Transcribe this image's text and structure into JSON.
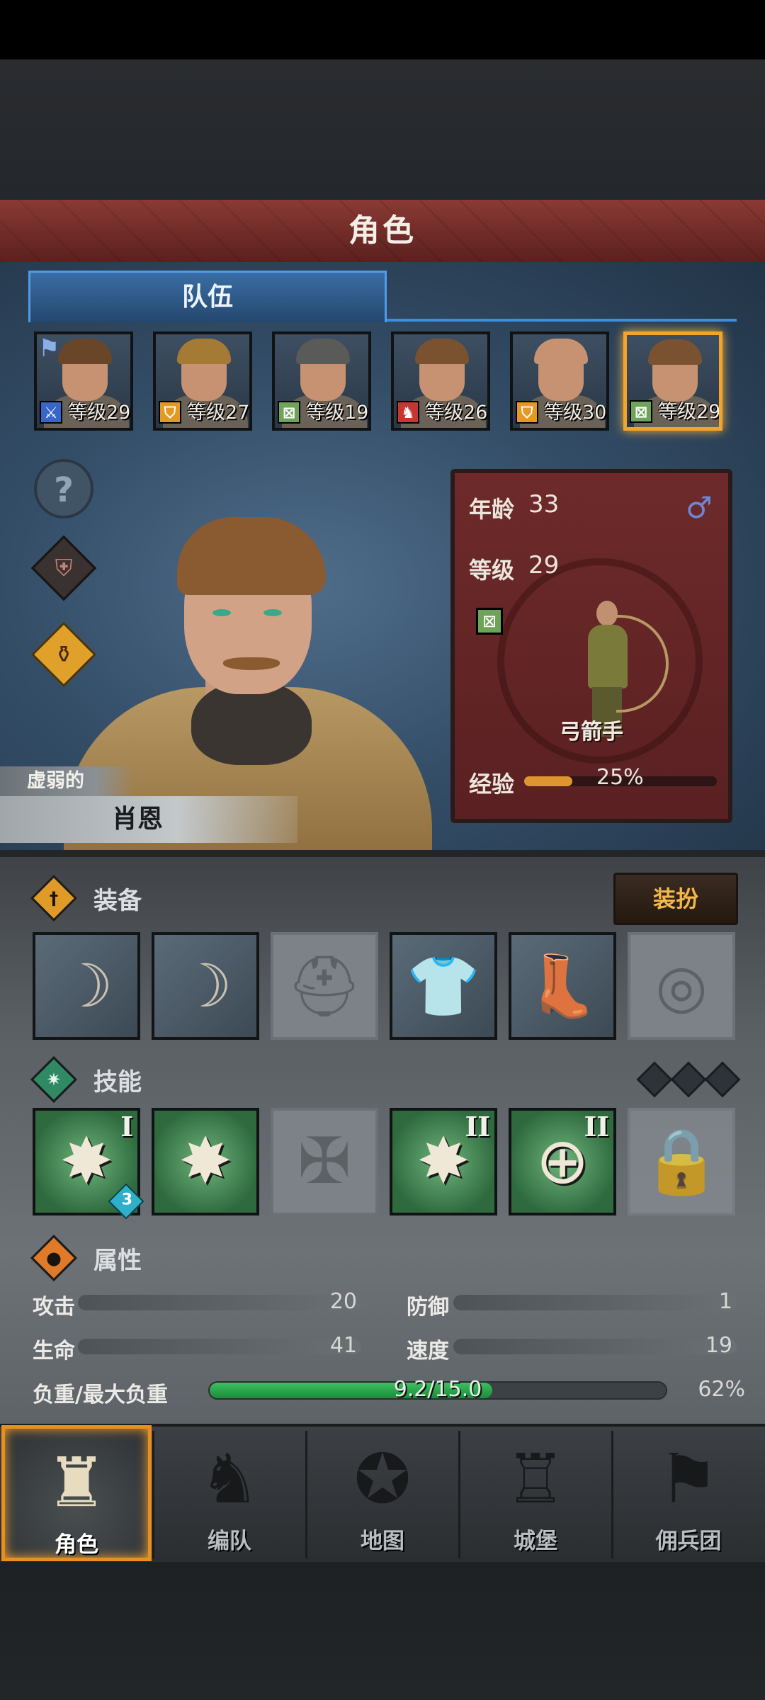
{
  "header": {
    "title": "角色"
  },
  "tabs": [
    {
      "label": "队伍"
    }
  ],
  "team": [
    {
      "class_icon": "sword-icon",
      "class_glyph": "⚔",
      "level_text": "等级29",
      "hair": "#6a4628",
      "banner": true
    },
    {
      "class_icon": "shield-icon",
      "class_glyph": "⛉",
      "level_text": "等级27",
      "hair": "#a57a34"
    },
    {
      "class_icon": "bow-icon",
      "class_glyph": "⊠",
      "level_text": "等级19",
      "hair": "#5a5a58"
    },
    {
      "class_icon": "beast-icon",
      "class_glyph": "♞",
      "level_text": "等级26",
      "hair": "#7a5230"
    },
    {
      "class_icon": "shield-icon",
      "class_glyph": "⛉",
      "level_text": "等级30",
      "hair": "#c79272"
    },
    {
      "class_icon": "bow-icon",
      "class_glyph": "⊠",
      "level_text": "等级29",
      "hair": "#7a5232",
      "selected": true
    }
  ],
  "side_icons": {
    "help": "?",
    "armor": "⛨",
    "potion": "⚱"
  },
  "hero": {
    "status": "虚弱的",
    "name": "肖恩"
  },
  "info": {
    "age_label": "年龄",
    "age": "33",
    "level_label": "等级",
    "level": "29",
    "gender_icon": "♂",
    "class_icon": "⊠",
    "class_name": "弓箭手",
    "exp_label": "经验",
    "exp_text": "25%",
    "exp_progress": 0.25
  },
  "sections": {
    "equipment": {
      "title": "装备",
      "icon": "†",
      "color": "#e09a28"
    },
    "skills": {
      "title": "技能",
      "icon": "✷",
      "color": "#2f8a64"
    },
    "attributes": {
      "title": "属性",
      "icon": "●",
      "color": "#e07a28"
    }
  },
  "dress_button": "装扮",
  "equipment_slots": [
    {
      "name": "bow-slot-1",
      "glyph": "☽",
      "filled": true
    },
    {
      "name": "bow-slot-2",
      "glyph": "☽",
      "filled": true
    },
    {
      "name": "helmet-slot",
      "glyph": "⛑",
      "filled": false
    },
    {
      "name": "chest-slot",
      "glyph": "👕",
      "filled": true
    },
    {
      "name": "boots-slot",
      "glyph": "👢",
      "filled": true
    },
    {
      "name": "ring-slot",
      "glyph": "◎",
      "filled": false
    }
  ],
  "skills": [
    {
      "glyph": "✸",
      "tier": "I",
      "badge": "3",
      "state": "filled"
    },
    {
      "glyph": "✸",
      "tier": "",
      "badge": "",
      "state": "filled"
    },
    {
      "glyph": "✠",
      "tier": "",
      "badge": "",
      "state": "empty"
    },
    {
      "glyph": "✸",
      "tier": "II",
      "badge": "",
      "state": "filled"
    },
    {
      "glyph": "⊕",
      "tier": "II",
      "badge": "",
      "state": "filled"
    },
    {
      "glyph": "🔒",
      "tier": "",
      "badge": "",
      "state": "lock"
    }
  ],
  "stats": {
    "attack_label": "攻击",
    "attack": "20",
    "defense_label": "防御",
    "defense": "1",
    "hp_label": "生命",
    "hp": "41",
    "speed_label": "速度",
    "speed": "19",
    "load_label": "负重/最大负重",
    "load_text": "9.2/15.0",
    "load_percent": "62%",
    "load_progress": 0.62
  },
  "nav": [
    {
      "label": "角色",
      "icon": "♜",
      "active": true
    },
    {
      "label": "编队",
      "icon": "♞"
    },
    {
      "label": "地图",
      "icon": "✪"
    },
    {
      "label": "城堡",
      "icon": "♖"
    },
    {
      "label": "佣兵团",
      "icon": "⚑"
    }
  ]
}
